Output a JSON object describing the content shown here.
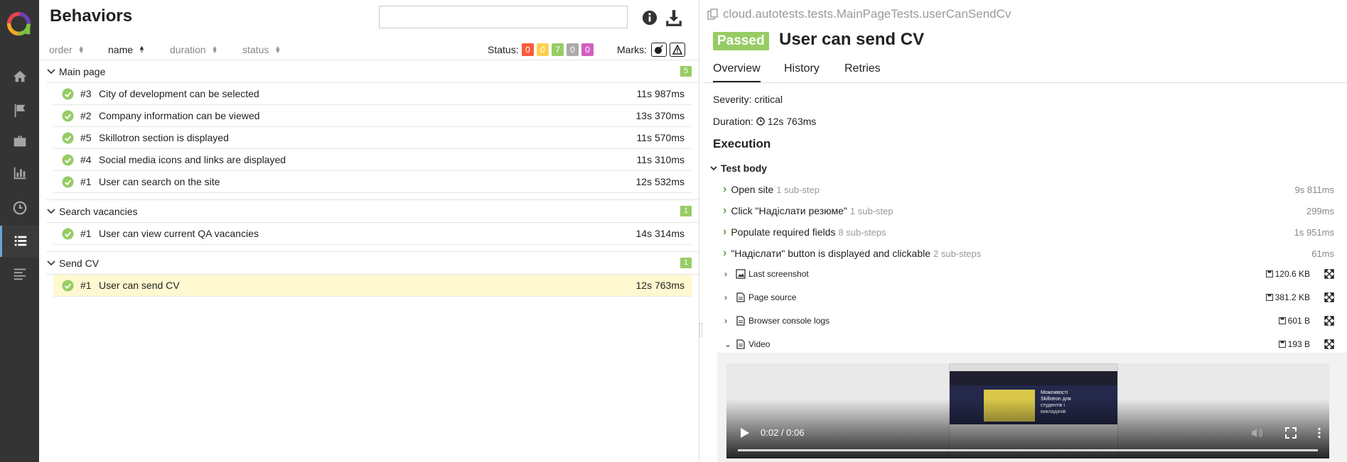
{
  "left": {
    "title": "Behaviors",
    "search": {
      "value": "",
      "placeholder": ""
    },
    "sort": {
      "order": "order",
      "name": "name",
      "duration": "duration",
      "status": "status"
    },
    "status_label": "Status:",
    "status_badges": [
      {
        "value": "0",
        "color": "#fd5a3e"
      },
      {
        "value": "0",
        "color": "#ffd050"
      },
      {
        "value": "7",
        "color": "#97cc64"
      },
      {
        "value": "0",
        "color": "#aaaaaa"
      },
      {
        "value": "0",
        "color": "#d35ebe"
      }
    ],
    "marks_label": "Marks:",
    "groups": [
      {
        "name": "Main page",
        "count": "5",
        "rows": [
          {
            "num": "#3",
            "name": "City of development can be selected",
            "duration": "11s 987ms"
          },
          {
            "num": "#2",
            "name": "Company information can be viewed",
            "duration": "13s 370ms"
          },
          {
            "num": "#5",
            "name": "Skillotron section is displayed",
            "duration": "11s 570ms"
          },
          {
            "num": "#4",
            "name": "Social media icons and links are displayed",
            "duration": "11s 310ms"
          },
          {
            "num": "#1",
            "name": "User can search on the site",
            "duration": "12s 532ms"
          }
        ]
      },
      {
        "name": "Search vacancies",
        "count": "1",
        "rows": [
          {
            "num": "#1",
            "name": "User can view current QA vacancies",
            "duration": "14s 314ms"
          }
        ]
      },
      {
        "name": "Send CV",
        "count": "1",
        "rows": [
          {
            "num": "#1",
            "name": "User can send CV",
            "duration": "12s 763ms"
          }
        ]
      }
    ]
  },
  "right": {
    "full_name": "cloud.autotests.tests.MainPageTests.userCanSendCv",
    "status": "Passed",
    "title": "User can send CV",
    "tabs": [
      "Overview",
      "History",
      "Retries"
    ],
    "severity": "Severity: critical",
    "duration_label": "Duration:",
    "duration": "12s 763ms",
    "execution": "Execution",
    "test_body": "Test body",
    "steps": [
      {
        "name": "Open site",
        "sub": "1 sub-step",
        "duration": "9s 811ms"
      },
      {
        "name": "Click \"Надіслати резюме\"",
        "sub": "1 sub-step",
        "duration": "299ms"
      },
      {
        "name": "Populate required fields",
        "sub": "8 sub-steps",
        "duration": "1s 951ms"
      },
      {
        "name": "\"Надіслати\" button is displayed and clickable",
        "sub": "2 sub-steps",
        "duration": "61ms"
      }
    ],
    "attachments": [
      {
        "name": "Last screenshot",
        "size": "120.6 KB",
        "icon": "image-icon"
      },
      {
        "name": "Page source",
        "size": "381.2 KB",
        "icon": "file-icon"
      },
      {
        "name": "Browser console logs",
        "size": "601 B",
        "icon": "file-icon"
      },
      {
        "name": "Video",
        "size": "193 B",
        "icon": "file-icon"
      }
    ],
    "video": {
      "time": "0:02 / 0:06",
      "progress": 0.33,
      "thumb_text": "Можливості Skillotron для студентів і викладачів"
    }
  }
}
